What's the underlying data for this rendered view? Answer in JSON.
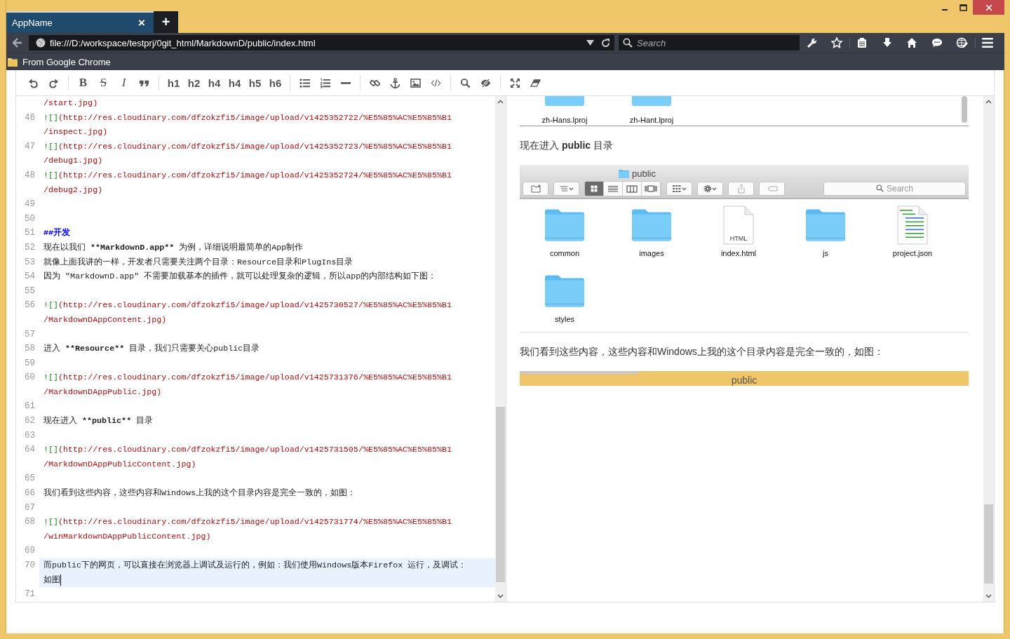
{
  "tabs": [
    {
      "title": "AppName",
      "close": "×",
      "selected": true
    }
  ],
  "new_tab": "+",
  "address_bar": {
    "url": "file:///D:/workspace/testprj/0git_html/MarkdownD/public/index.html"
  },
  "search_bar": {
    "placeholder": "Search"
  },
  "bookmarks": [
    {
      "label": "From Google Chrome"
    }
  ],
  "toolbar": {
    "groups": [
      [
        {
          "kind": "undo"
        },
        {
          "kind": "redo"
        }
      ],
      [
        {
          "kind": "bold",
          "label": "B"
        },
        {
          "kind": "strike",
          "label": "S"
        },
        {
          "kind": "italic",
          "label": "I"
        },
        {
          "kind": "quote"
        }
      ],
      [
        {
          "kind": "text",
          "label": "h1"
        },
        {
          "kind": "text",
          "label": "h2"
        },
        {
          "kind": "text",
          "label": "h4"
        },
        {
          "kind": "text",
          "label": "h4"
        },
        {
          "kind": "text",
          "label": "h5"
        },
        {
          "kind": "text",
          "label": "h6"
        }
      ],
      [
        {
          "kind": "bullets"
        },
        {
          "kind": "numbers"
        },
        {
          "kind": "rule"
        }
      ],
      [
        {
          "kind": "link"
        },
        {
          "kind": "anchor"
        },
        {
          "kind": "image"
        },
        {
          "kind": "code"
        }
      ],
      [
        {
          "kind": "search"
        },
        {
          "kind": "preview"
        }
      ],
      [
        {
          "kind": "fullscreen"
        },
        {
          "kind": "eraser"
        }
      ]
    ]
  },
  "editor": {
    "lines": [
      {
        "current": false,
        "rows": [
          [
            {
              "kind": "url",
              "text": "/start.jpg)"
            }
          ]
        ]
      },
      {
        "number": "46",
        "current": false,
        "rows": [
          [
            {
              "kind": "mark",
              "text": "![]"
            },
            {
              "kind": "url",
              "text": "(http://res.cloudinary.com/dfzokzfi5/image/upload/v1425352722/%E5%85%AC%E5%85%B1"
            }
          ],
          [
            {
              "kind": "url",
              "text": "/inspect.jpg)"
            }
          ]
        ]
      },
      {
        "number": "47",
        "current": false,
        "rows": [
          [
            {
              "kind": "mark",
              "text": "![]"
            },
            {
              "kind": "url",
              "text": "(http://res.cloudinary.com/dfzokzfi5/image/upload/v1425352723/%E5%85%AC%E5%85%B1"
            }
          ],
          [
            {
              "kind": "url",
              "text": "/debug1.jpg)"
            }
          ]
        ]
      },
      {
        "number": "48",
        "current": false,
        "rows": [
          [
            {
              "kind": "mark",
              "text": "![]"
            },
            {
              "kind": "url",
              "text": "(http://res.cloudinary.com/dfzokzfi5/image/upload/v1425352724/%E5%85%AC%E5%85%B1"
            }
          ],
          [
            {
              "kind": "url",
              "text": "/debug2.jpg)"
            }
          ]
        ]
      },
      {
        "number": "49",
        "current": false
      },
      {
        "number": "50",
        "current": false
      },
      {
        "number": "51",
        "current": false,
        "rows": [
          [
            {
              "kind": "header",
              "text": "##开发"
            }
          ]
        ]
      },
      {
        "number": "52",
        "current": false,
        "rows": [
          [
            {
              "kind": "plain",
              "text": "现在以我们 "
            },
            {
              "kind": "strong",
              "text": "**MarkdownD.app**"
            },
            {
              "kind": "plain",
              "text": " 为例，详细说明最简单的App制作"
            }
          ]
        ]
      },
      {
        "number": "53",
        "current": false,
        "rows": [
          [
            {
              "kind": "plain",
              "text": "就像上面我讲的一样，开发者只需要关注两个目录：Resource目录和PlugIns目录"
            }
          ]
        ]
      },
      {
        "number": "54",
        "current": false,
        "rows": [
          [
            {
              "kind": "plain",
              "text": "因为 \"MarkdownD.app\" 不需要加载基本的插件，就可以处理复杂的逻辑，所以app的内部结构如下图："
            }
          ]
        ]
      },
      {
        "number": "55",
        "current": false
      },
      {
        "number": "56",
        "current": false,
        "rows": [
          [
            {
              "kind": "mark",
              "text": "![]"
            },
            {
              "kind": "url",
              "text": "(http://res.cloudinary.com/dfzokzfi5/image/upload/v1425730527/%E5%85%AC%E5%85%B1"
            }
          ],
          [
            {
              "kind": "url",
              "text": "/MarkdownDAppContent.jpg)"
            }
          ]
        ]
      },
      {
        "number": "57",
        "current": false
      },
      {
        "number": "58",
        "current": false,
        "rows": [
          [
            {
              "kind": "plain",
              "text": "进入 "
            },
            {
              "kind": "strong",
              "text": "**Resource**"
            },
            {
              "kind": "plain",
              "text": " 目录，我们只需要关心public目录"
            }
          ]
        ]
      },
      {
        "number": "59",
        "current": false
      },
      {
        "number": "60",
        "current": false,
        "rows": [
          [
            {
              "kind": "mark",
              "text": "![]"
            },
            {
              "kind": "url",
              "text": "(http://res.cloudinary.com/dfzokzfi5/image/upload/v1425731376/%E5%85%AC%E5%85%B1"
            }
          ],
          [
            {
              "kind": "url",
              "text": "/MarkdownDAppPublic.jpg)"
            }
          ]
        ]
      },
      {
        "number": "61",
        "current": false
      },
      {
        "number": "62",
        "current": false,
        "rows": [
          [
            {
              "kind": "plain",
              "text": "现在进入 "
            },
            {
              "kind": "strong",
              "text": "**public**"
            },
            {
              "kind": "plain",
              "text": " 目录"
            }
          ]
        ]
      },
      {
        "number": "63",
        "current": false
      },
      {
        "number": "64",
        "current": false,
        "rows": [
          [
            {
              "kind": "mark",
              "text": "![]"
            },
            {
              "kind": "url",
              "text": "(http://res.cloudinary.com/dfzokzfi5/image/upload/v1425731505/%E5%85%AC%E5%85%B1"
            }
          ],
          [
            {
              "kind": "url",
              "text": "/MarkdownDAppPublicContent.jpg)"
            }
          ]
        ]
      },
      {
        "number": "65",
        "current": false
      },
      {
        "number": "66",
        "current": false,
        "rows": [
          [
            {
              "kind": "plain",
              "text": "我们看到这些内容，这些内容和Windows上我的这个目录内容是完全一致的，如图："
            }
          ]
        ]
      },
      {
        "number": "67",
        "current": false
      },
      {
        "number": "68",
        "current": false,
        "rows": [
          [
            {
              "kind": "mark",
              "text": "![]"
            },
            {
              "kind": "url",
              "text": "(http://res.cloudinary.com/dfzokzfi5/image/upload/v1425731774/%E5%85%AC%E5%85%B1"
            }
          ],
          [
            {
              "kind": "url",
              "text": "/winMarkdownDAppPublicContent.jpg)"
            }
          ]
        ]
      },
      {
        "number": "69",
        "current": false
      },
      {
        "number": "70",
        "current": true,
        "rows": [
          [
            {
              "kind": "plain",
              "text": "而public下的网页，可以直接在浏览器上调试及运行的，例如：我们使用Windows版本Firefox 运行，及调试："
            }
          ],
          [
            {
              "kind": "plain",
              "text": "如图"
            }
          ]
        ]
      },
      {
        "number": "71",
        "current": false
      }
    ]
  },
  "preview": {
    "blocks": [
      {
        "kind": "finder-partial",
        "items": [
          {
            "name": "zh-Hans.lproj"
          },
          {
            "name": "zh-Hant.lproj"
          }
        ]
      },
      {
        "kind": "paragraph",
        "text": "现在进入 **public** 目录"
      },
      {
        "kind": "finder",
        "title": "public",
        "search_placeholder": "Search",
        "view_modes": [
          {
            "kind": "icons",
            "selected": true
          },
          {
            "kind": "list",
            "selected": false
          },
          {
            "kind": "columns",
            "selected": false
          },
          {
            "kind": "coverflow",
            "selected": false
          }
        ],
        "items": [
          {
            "kind": "folder",
            "name": "common"
          },
          {
            "kind": "folder",
            "name": "images"
          },
          {
            "kind": "html",
            "name": "index.html",
            "badge": "HTML"
          },
          {
            "kind": "folder",
            "name": "js"
          },
          {
            "kind": "json",
            "name": "project.json"
          },
          {
            "kind": "folder",
            "name": "styles"
          }
        ]
      },
      {
        "kind": "paragraph",
        "text": "我们看到这些内容，这些内容和Windows上我的这个目录内容是完全一致的，如图："
      },
      {
        "kind": "window-strip",
        "title": "public"
      }
    ]
  }
}
